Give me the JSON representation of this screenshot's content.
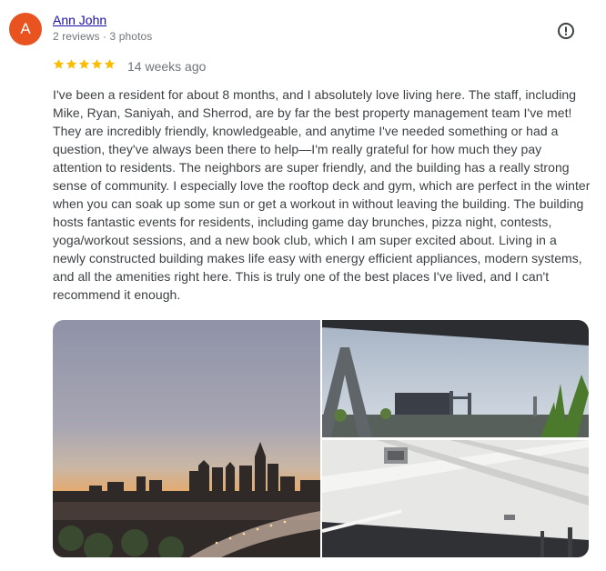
{
  "review": {
    "avatar_letter": "A",
    "avatar_color": "#e8531f",
    "author_name": "Ann John",
    "author_meta": "2 reviews · 3 photos",
    "rating": 5,
    "time_ago": "14 weeks ago",
    "star_color": "#fbbc04",
    "text": "I've been a resident for about 8 months, and I absolutely love living here. The staff, including Mike, Ryan, Saniyah, and Sherrod, are by far the best property management team I've met! They are incredibly friendly, knowledgeable, and anytime I've needed something or had a question, they've always been there to help—I'm really grateful for how much they pay attention to residents. The neighbors are super friendly, and the building has a really strong sense of community. I especially love the rooftop deck and gym, which are perfect in the winter when you can soak up some sun or get a workout in without leaving the building. The building hosts fantastic events for residents, including game day brunches, pizza night, contests, yoga/workout sessions, and a new book club, which I am super excited about. Living in a newly constructed building makes life easy with energy efficient appliances, modern systems, and all the amenities right here. This is truly one of the best places I've lived, and I can't recommend it enough.",
    "flag_icon": "report-icon"
  },
  "photos": [
    {
      "name": "photo-city-skyline-sunset"
    },
    {
      "name": "photo-rooftop-bridge-view"
    },
    {
      "name": "photo-interior-ceiling"
    }
  ]
}
